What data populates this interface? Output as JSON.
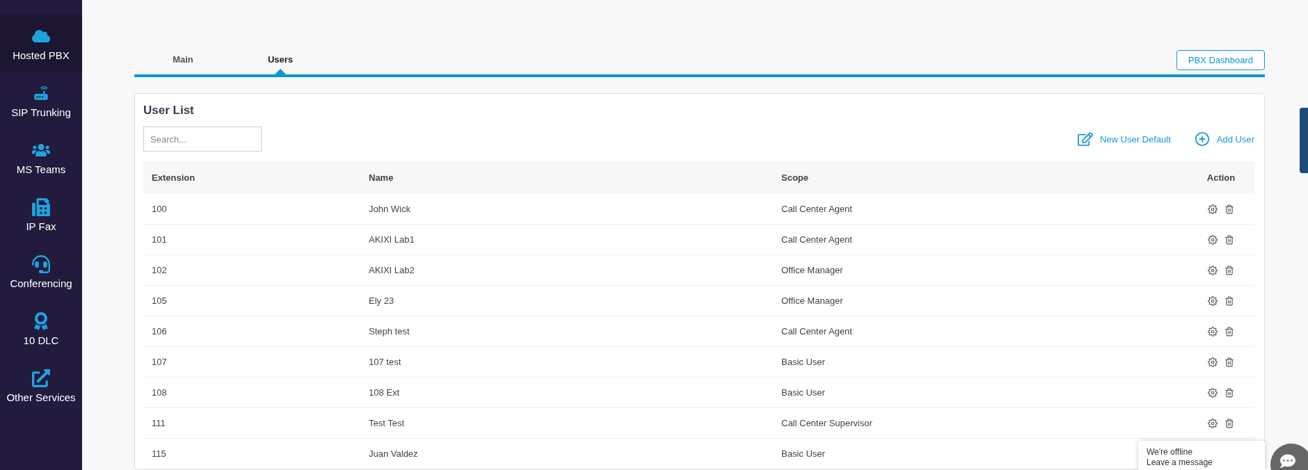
{
  "sidebar": {
    "items": [
      {
        "label": "Hosted PBX",
        "selected": true
      },
      {
        "label": "SIP Trunking",
        "selected": false
      },
      {
        "label": "MS Teams",
        "selected": false
      },
      {
        "label": "IP Fax",
        "selected": false
      },
      {
        "label": "Conferencing",
        "selected": false
      },
      {
        "label": "10 DLC",
        "selected": false
      },
      {
        "label": "Other Services",
        "selected": false
      }
    ]
  },
  "tabs": [
    {
      "label": "Main",
      "selected": false
    },
    {
      "label": "Users",
      "selected": true
    }
  ],
  "dashboard_button": "PBX Dashboard",
  "user_list": {
    "title": "User List",
    "search": {
      "placeholder": "Search..."
    },
    "actions": [
      "New User Default",
      "Add User"
    ],
    "table": {
      "columns": [
        "Extension",
        "Name",
        "Scope",
        "Action"
      ],
      "rows": [
        {
          "extension": "100",
          "name": "John Wick",
          "scope": "Call Center Agent"
        },
        {
          "extension": "101",
          "name": "AKIXI Lab1",
          "scope": "Call Center Agent"
        },
        {
          "extension": "102",
          "name": "AKIXI Lab2",
          "scope": "Office Manager"
        },
        {
          "extension": "105",
          "name": "Ely 23",
          "scope": "Office Manager"
        },
        {
          "extension": "106",
          "name": "Steph test",
          "scope": "Call Center Agent"
        },
        {
          "extension": "107",
          "name": "107 test",
          "scope": "Basic User"
        },
        {
          "extension": "108",
          "name": "108 Ext",
          "scope": "Basic User"
        },
        {
          "extension": "111",
          "name": "Test Test",
          "scope": "Call Center Supervisor"
        },
        {
          "extension": "115",
          "name": "Juan Valdez",
          "scope": "Basic User"
        }
      ]
    }
  },
  "chat": {
    "status": "We're offline",
    "hint": "Leave a message"
  }
}
